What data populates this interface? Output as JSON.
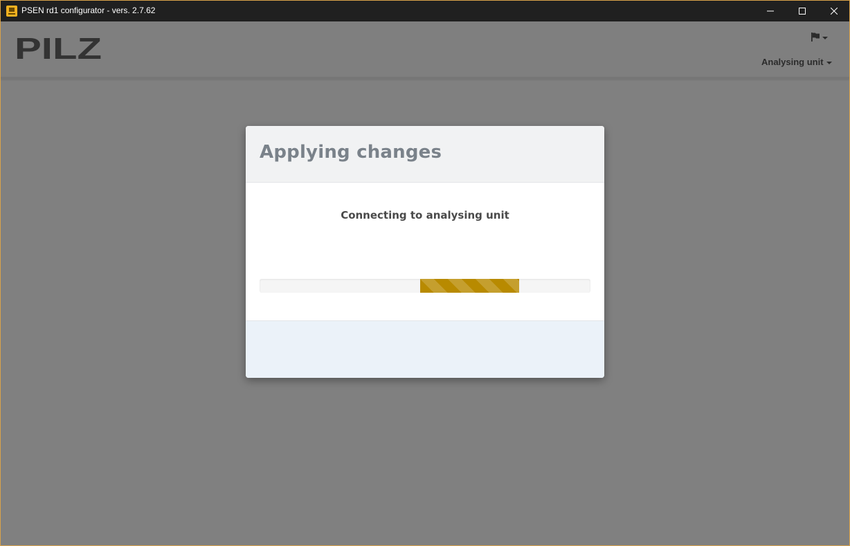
{
  "window": {
    "title": "PSEN rd1 configurator - vers. 2.7.62",
    "icon": "app-icon",
    "controls": {
      "minimize_icon": "minimize-icon",
      "maximize_icon": "maximize-icon",
      "close_icon": "close-icon"
    }
  },
  "header": {
    "logo_text": "PILZ",
    "language_menu_icon": "flag-icon",
    "unit_menu_label": "Analysing unit"
  },
  "modal": {
    "title": "Applying changes",
    "status": "Connecting to analysing unit",
    "progress": {
      "type": "indeterminate",
      "visible_segment_start_percent": 48.5,
      "visible_segment_end_percent": 78.5,
      "color": "#b88a00"
    }
  },
  "colors": {
    "backdrop": "#808080",
    "titlebar": "#202020",
    "accent": "#b88a00",
    "modal_header": "#f1f2f3",
    "modal_footer": "#ebf2f9"
  }
}
